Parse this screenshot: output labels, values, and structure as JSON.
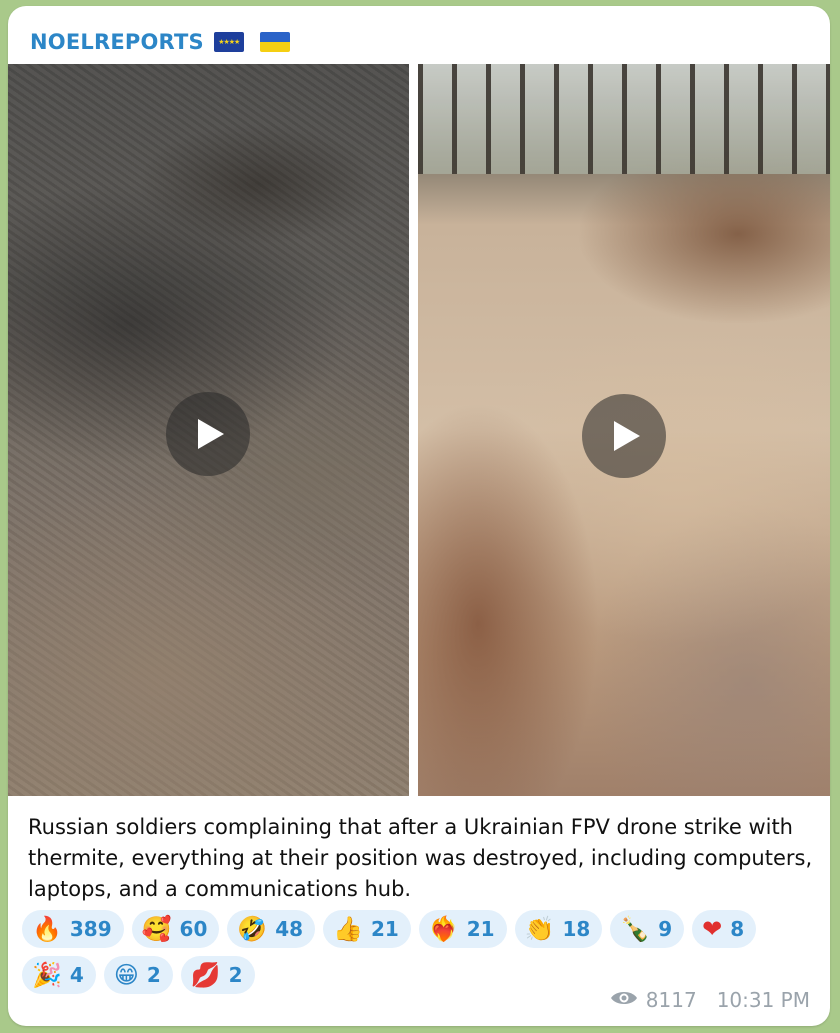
{
  "channel": {
    "name": "NOELREPORTS",
    "flag1": "EU flag",
    "flag2": "Ukraine flag"
  },
  "media": [
    {
      "name": "video-thumbnail-left",
      "icon": "play-icon"
    },
    {
      "name": "video-thumbnail-right",
      "icon": "play-icon"
    }
  ],
  "caption": "Russian soldiers complaining that after a Ukrainian FPV drone strike with thermite, everything at their position was destroyed, including computers, laptops, and a communications hub.",
  "reactions": [
    {
      "emoji": "🔥",
      "count": "389"
    },
    {
      "emoji": "🥰",
      "count": "60"
    },
    {
      "emoji": "🤣",
      "count": "48"
    },
    {
      "emoji": "👍",
      "count": "21"
    },
    {
      "emoji": "❤‍🔥",
      "count": "21"
    },
    {
      "emoji": "👏",
      "count": "18"
    },
    {
      "emoji": "🍾",
      "count": "9"
    },
    {
      "emoji": "❤",
      "count": "8"
    },
    {
      "emoji": "🎉",
      "count": "4"
    },
    {
      "emoji": "😁",
      "count": "2"
    },
    {
      "emoji": "💋",
      "count": "2"
    }
  ],
  "meta": {
    "views": "8117",
    "time": "10:31 PM"
  },
  "colors": {
    "accent": "#2c86c7",
    "pill_bg": "#e3f0fb",
    "background": "#a9c98a",
    "meta_text": "#9aa3ab"
  }
}
